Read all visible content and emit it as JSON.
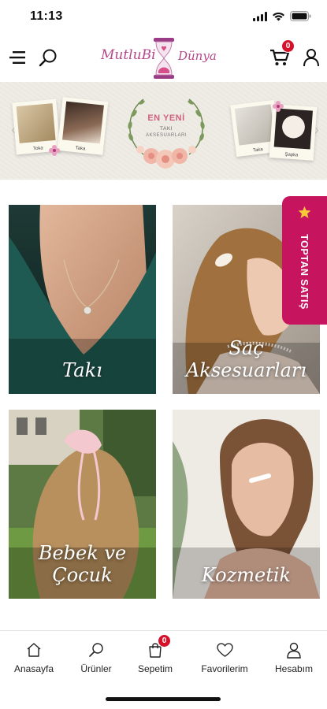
{
  "status_bar": {
    "time": "11:13"
  },
  "header": {
    "logo": {
      "text_left": "MutluBi",
      "text_right": "Dünya"
    },
    "cart_badge": "0"
  },
  "banner": {
    "title": "EN YENİ",
    "subtitle_line1": "TAKI",
    "subtitle_line2": "AKSESUARLARI",
    "polaroids": [
      {
        "caption": "Toka"
      },
      {
        "caption": "Taka"
      },
      {
        "caption": "Taka"
      },
      {
        "caption": "Şapka"
      }
    ]
  },
  "categories": [
    {
      "label": "Takı"
    },
    {
      "label": "Saç Aksesuarları"
    },
    {
      "label": "Bebek ve Çocuk"
    },
    {
      "label": "Kozmetik"
    }
  ],
  "side_tab": {
    "label": "TOPTAN SATIŞ",
    "icon": "star-icon"
  },
  "tab_bar": {
    "items": [
      {
        "label": "Anasayfa",
        "icon": "home-icon"
      },
      {
        "label": "Ürünler",
        "icon": "search-icon"
      },
      {
        "label": "Sepetim",
        "icon": "bag-icon",
        "badge": "0"
      },
      {
        "label": "Favorilerim",
        "icon": "heart-icon"
      },
      {
        "label": "Hesabım",
        "icon": "user-icon"
      }
    ]
  },
  "colors": {
    "brand_pink": "#c6145f",
    "badge_red": "#d7102a",
    "logo_purple": "#b5478a"
  }
}
